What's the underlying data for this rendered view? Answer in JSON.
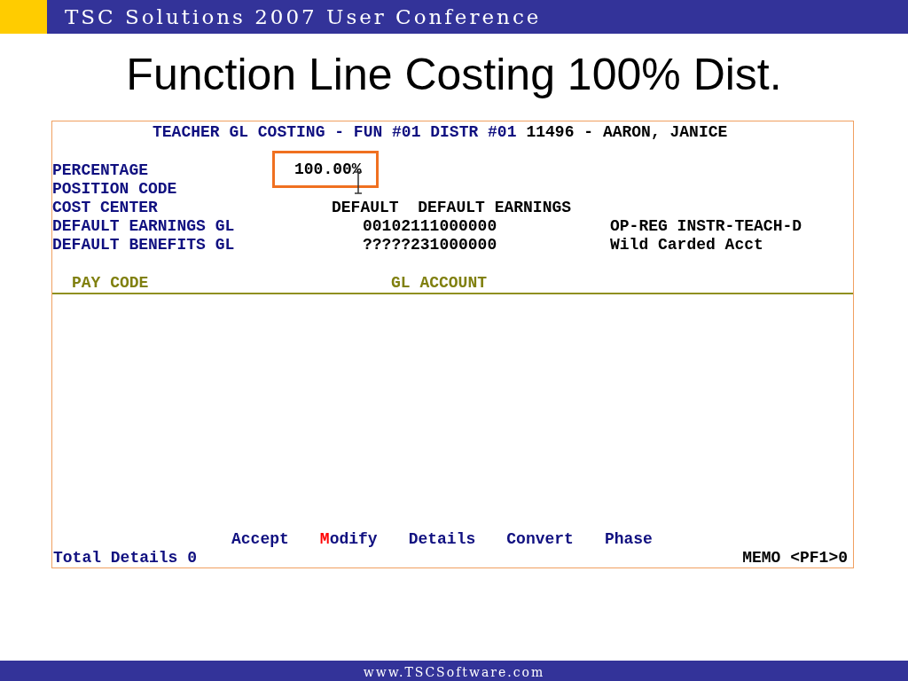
{
  "header": {
    "title": "TSC Solutions 2007 User Conference"
  },
  "slide_title": "Function Line Costing 100% Dist.",
  "screen": {
    "heading": {
      "screen_name": "TEACHER GL COSTING - FUN #01 DISTR #01",
      "employee": "11496 - AARON, JANICE"
    },
    "fields": [
      {
        "label": "PERCENTAGE",
        "value": "100.00%",
        "highlighted": true
      },
      {
        "label": "POSITION CODE"
      },
      {
        "label": "COST CENTER",
        "value": "DEFAULT  DEFAULT EARNINGS"
      },
      {
        "label": "DEFAULT EARNINGS GL",
        "value": "00102111000000",
        "description": "OP-REG INSTR-TEACH-D"
      },
      {
        "label": "DEFAULT BENEFITS GL",
        "value": "?????231000000",
        "description": "Wild Carded Acct"
      }
    ],
    "table": {
      "columns": [
        "PAY CODE",
        "GL ACCOUNT"
      ]
    },
    "menu": [
      {
        "label": "Accept",
        "selected": false
      },
      {
        "label": "Modify",
        "selected": true
      },
      {
        "label": "Details",
        "selected": false
      },
      {
        "label": "Convert",
        "selected": false
      },
      {
        "label": "Phase",
        "selected": false
      }
    ],
    "status": {
      "total": "Total Details 0",
      "memo": "MEMO <PF1>0"
    }
  },
  "footer": {
    "url": "www.TSCSoftware.com"
  }
}
